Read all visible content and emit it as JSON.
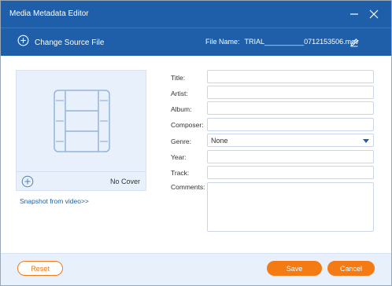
{
  "window": {
    "title": "Media Metadata Editor"
  },
  "source": {
    "change_label": "Change Source File",
    "filename_label": "File Name:",
    "filename_value": "TRIAL__________0712153506.mov"
  },
  "cover": {
    "no_cover_label": "No Cover",
    "snapshot_link": "Snapshot from video>>"
  },
  "fields": {
    "title_label": "Title:",
    "artist_label": "Artist:",
    "album_label": "Album:",
    "composer_label": "Composer:",
    "genre_label": "Genre:",
    "genre_value": "None",
    "year_label": "Year:",
    "track_label": "Track:",
    "comments_label": "Comments:"
  },
  "footer": {
    "reset_label": "Reset",
    "save_label": "Save",
    "cancel_label": "Cancel"
  },
  "colors": {
    "titlebar": "#1f5ea8",
    "accent_orange": "#f47a14",
    "panel_light_blue": "#e7f0fb"
  },
  "icons": {
    "add": "plus-circle-icon",
    "edit": "pencil-icon",
    "cover": "film-strip-icon",
    "minimize": "minimize-icon",
    "close": "close-icon"
  }
}
